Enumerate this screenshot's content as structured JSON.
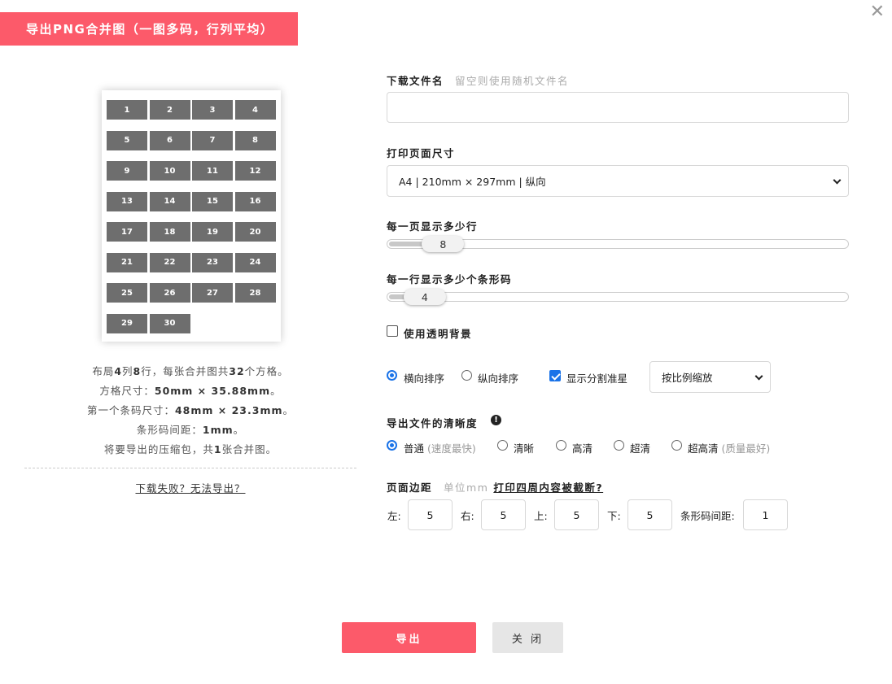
{
  "dialog": {
    "title": "导出PNG合并图（一图多码，行列平均）",
    "close_symbol": "✕"
  },
  "preview": {
    "cells": [
      "1",
      "2",
      "3",
      "4",
      "5",
      "6",
      "7",
      "8",
      "9",
      "10",
      "11",
      "12",
      "13",
      "14",
      "15",
      "16",
      "17",
      "18",
      "19",
      "20",
      "21",
      "22",
      "23",
      "24",
      "25",
      "26",
      "27",
      "28",
      "29",
      "30"
    ]
  },
  "summary": {
    "line1": {
      "a": "布局",
      "cols": "4",
      "b": "列",
      "rows": "8",
      "c": "行，每张合并图共",
      "total": "32",
      "d": "个方格。"
    },
    "line2": {
      "a": "方格尺寸：",
      "v": "50mm × 35.88mm",
      "b": "。"
    },
    "line3": {
      "a": "第一个条码尺寸：",
      "v": "48mm × 23.3mm",
      "b": "。"
    },
    "line4": {
      "a": "条形码间距：",
      "v": "1mm",
      "b": "。"
    },
    "line5": {
      "a": "将要导出的压缩包，共",
      "v": "1",
      "b": "张合并图。"
    },
    "fail_link": "下载失败？无法导出？"
  },
  "form": {
    "filename": {
      "label": "下载文件名",
      "hint": "留空则使用随机文件名",
      "value": ""
    },
    "page_size": {
      "label": "打印页面尺寸",
      "value": "A4 | 210mm × 297mm | 纵向"
    },
    "rows_per_page": {
      "label": "每一页显示多少行",
      "value": "8",
      "fraction": 0.1
    },
    "codes_per_row": {
      "label": "每一行显示多少个条形码",
      "value": "4",
      "fraction": 0.06
    },
    "transparent_bg": {
      "label": "使用透明背景",
      "checked": false
    },
    "sort": {
      "horizontal": "横向排序",
      "vertical": "纵向排序",
      "selected": "horizontal"
    },
    "show_crop_marks": {
      "label": "显示分割准星",
      "checked": true
    },
    "scale_mode": {
      "value": "按比例缩放"
    },
    "quality": {
      "label": "导出文件的清晰度",
      "info_symbol": "!",
      "options": [
        {
          "label": "普通",
          "sub": "(速度最快)"
        },
        {
          "label": "清晰",
          "sub": ""
        },
        {
          "label": "高清",
          "sub": ""
        },
        {
          "label": "超清",
          "sub": ""
        },
        {
          "label": "超高清",
          "sub": "(质量最好)"
        }
      ],
      "selected_index": 0
    },
    "margins": {
      "label": "页面边距",
      "unit_hint": "单位mm",
      "link": "打印四周内容被截断?",
      "left_label": "左:",
      "left": "5",
      "right_label": "右:",
      "right": "5",
      "top_label": "上:",
      "top": "5",
      "bottom_label": "下:",
      "bottom": "5",
      "gap_label": "条形码间距:",
      "gap": "1"
    }
  },
  "buttons": {
    "export": "导出",
    "close": "关 闭"
  },
  "colors": {
    "accent": "#fc5a6a",
    "cell": "#6e6e6e",
    "checkbox": "#1a73e8"
  }
}
